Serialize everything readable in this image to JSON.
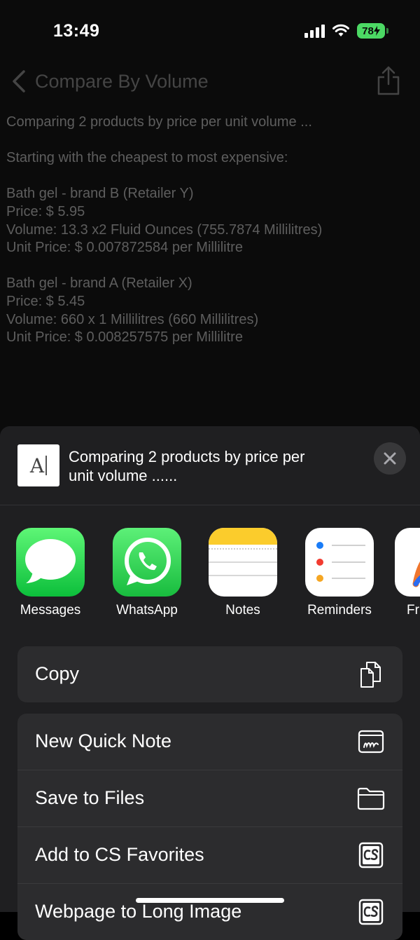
{
  "status_bar": {
    "time": "13:49",
    "battery": "78"
  },
  "nav": {
    "title": "Compare By Volume"
  },
  "report": {
    "lines": [
      "Comparing 2 products by price per unit volume ...",
      "",
      "Starting with the cheapest to most expensive:",
      "",
      "Bath gel - brand B (Retailer Y)",
      "Price: $ 5.95",
      "Volume: 13.3 x2 Fluid Ounces (755.7874 Millilitres)",
      "Unit Price: $ 0.007872584 per Millilitre",
      "",
      "Bath gel - brand A (Retailer X)",
      "Price: $ 5.45",
      "Volume: 660 x 1 Millilitres (660 Millilitres)",
      "Unit Price: $ 0.008257575 per Millilitre"
    ]
  },
  "share_sheet": {
    "preview_title": "Comparing 2 products by price per unit volume ......",
    "apps": [
      {
        "label": "Messages",
        "icon": "messages-icon"
      },
      {
        "label": "WhatsApp",
        "icon": "whatsapp-icon"
      },
      {
        "label": "Notes",
        "icon": "notes-icon"
      },
      {
        "label": "Reminders",
        "icon": "reminders-icon"
      },
      {
        "label": "Fr",
        "icon": "freeform-icon"
      }
    ],
    "copy": {
      "label": "Copy",
      "icon": "copy-icon"
    },
    "actions": [
      {
        "label": "New Quick Note",
        "icon": "quick-note-icon"
      },
      {
        "label": "Save to Files",
        "icon": "folder-icon"
      },
      {
        "label": "Add to CS Favorites",
        "icon": "cs-icon"
      },
      {
        "label": "Webpage to Long Image",
        "icon": "cs-icon"
      }
    ]
  },
  "colors": {
    "sheet_bg": "#1f1f21",
    "row_bg": "#2c2c2e",
    "battery": "#4cd964",
    "dim_text": "#5e5e5e"
  }
}
